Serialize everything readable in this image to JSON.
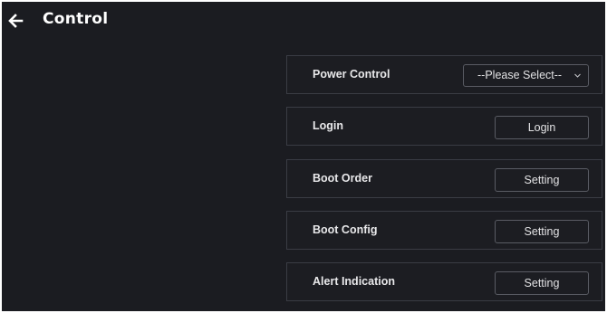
{
  "header": {
    "title": "Control",
    "back_icon": "arrow-left-icon"
  },
  "rows": [
    {
      "label": "Power Control",
      "control": "select",
      "value": "--Please Select--",
      "icon": "chevron-down-icon"
    },
    {
      "label": "Login",
      "control": "button",
      "button_label": "Login"
    },
    {
      "label": "Boot Order",
      "control": "button",
      "button_label": "Setting"
    },
    {
      "label": "Boot Config",
      "control": "button",
      "button_label": "Setting"
    },
    {
      "label": "Alert Indication",
      "control": "button",
      "button_label": "Setting"
    }
  ],
  "colors": {
    "background": "#1b1c21",
    "row_border": "#3a3c44",
    "text": "#ffffff"
  }
}
